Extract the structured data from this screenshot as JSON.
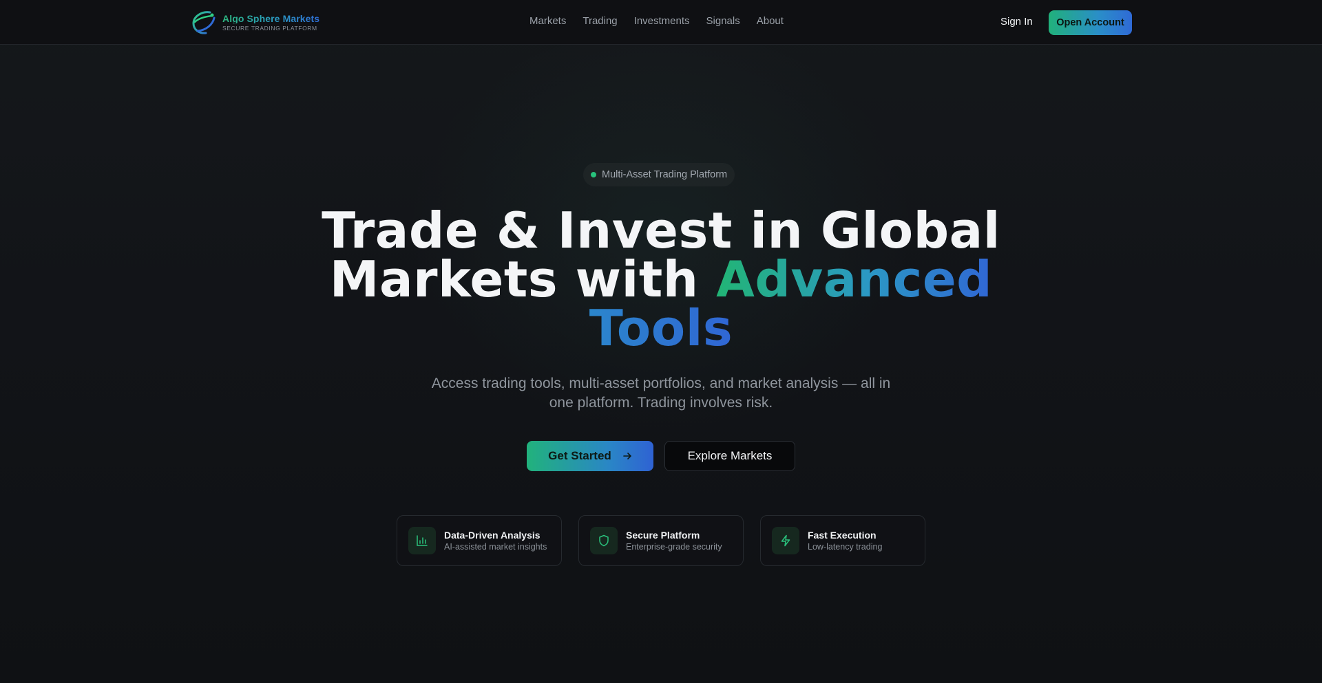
{
  "brand": {
    "name_part1": "Algo Sphere",
    "name_part2": "Markets",
    "tagline": "SECURE TRADING PLATFORM",
    "colors": {
      "green": "#22b575",
      "blue": "#3066d4"
    }
  },
  "nav": {
    "links": [
      "Markets",
      "Trading",
      "Investments",
      "Signals",
      "About"
    ],
    "sign_in": "Sign In",
    "open_account": "Open Account"
  },
  "hero": {
    "badge": "Multi-Asset Trading Platform",
    "headline_line1": "Trade & Invest in Global",
    "headline_line2_plain": "Markets with ",
    "headline_line2_accent": "Advanced",
    "headline_line3_accent": "Tools",
    "subtext": "Access trading tools, multi-asset portfolios, and market analysis — all in one platform. Trading involves risk.",
    "primary_button": "Get Started",
    "secondary_button": "Explore Markets"
  },
  "features": [
    {
      "icon": "bar-chart-icon",
      "title": "Data-Driven Analysis",
      "desc": "AI-assisted market insights"
    },
    {
      "icon": "shield-icon",
      "title": "Secure Platform",
      "desc": "Enterprise-grade security"
    },
    {
      "icon": "lightning-icon",
      "title": "Fast Execution",
      "desc": "Low-latency trading"
    }
  ]
}
